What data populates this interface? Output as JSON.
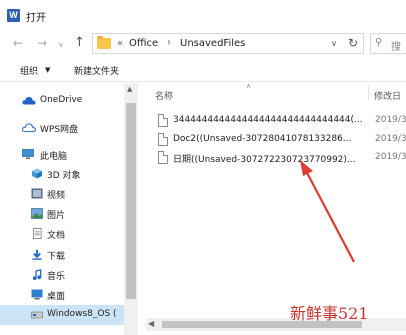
{
  "window": {
    "title": "打开",
    "app_icon_letter": "W"
  },
  "address": {
    "back_icon": "arrow-left-icon",
    "forward_icon": "arrow-right-icon",
    "up_icon": "arrow-up-icon",
    "overflow": "«",
    "crumbs": [
      "Office",
      "UnsavedFiles"
    ],
    "separator": "›",
    "search_placeholder": "搜"
  },
  "toolbar": {
    "organize_label": "组织",
    "organize_caret": "▼",
    "new_folder_label": "新建文件夹"
  },
  "sidebar": {
    "items": [
      {
        "label": "OneDrive",
        "icon": "onedrive-icon"
      },
      {
        "label": "WPS网盘",
        "icon": "wps-cloud-icon"
      },
      {
        "label": "此电脑",
        "icon": "this-pc-icon"
      },
      {
        "label": "3D 对象",
        "icon": "3d-objects-icon"
      },
      {
        "label": "视频",
        "icon": "videos-icon"
      },
      {
        "label": "图片",
        "icon": "pictures-icon"
      },
      {
        "label": "文档",
        "icon": "documents-icon"
      },
      {
        "label": "下载",
        "icon": "downloads-icon"
      },
      {
        "label": "音乐",
        "icon": "music-icon"
      },
      {
        "label": "桌面",
        "icon": "desktop-icon"
      },
      {
        "label": "Windows8_OS (",
        "icon": "drive-icon",
        "selected": true
      }
    ]
  },
  "files": {
    "columns": {
      "name": "名称",
      "date": "修改日"
    },
    "rows": [
      {
        "name": "3444444444444444444444444444444(...",
        "date": "2019/3"
      },
      {
        "name": "Doc2((Unsaved-30728041078133286...",
        "date": "2019/3"
      },
      {
        "name": "日期((Unsaved-307272230723770992)...",
        "date": "2019/3"
      }
    ]
  },
  "watermark": "新鲜事521",
  "colors": {
    "accent_selection": "#cce4f7",
    "folder": "#f5c84c",
    "annotation_red": "#e03a32"
  }
}
